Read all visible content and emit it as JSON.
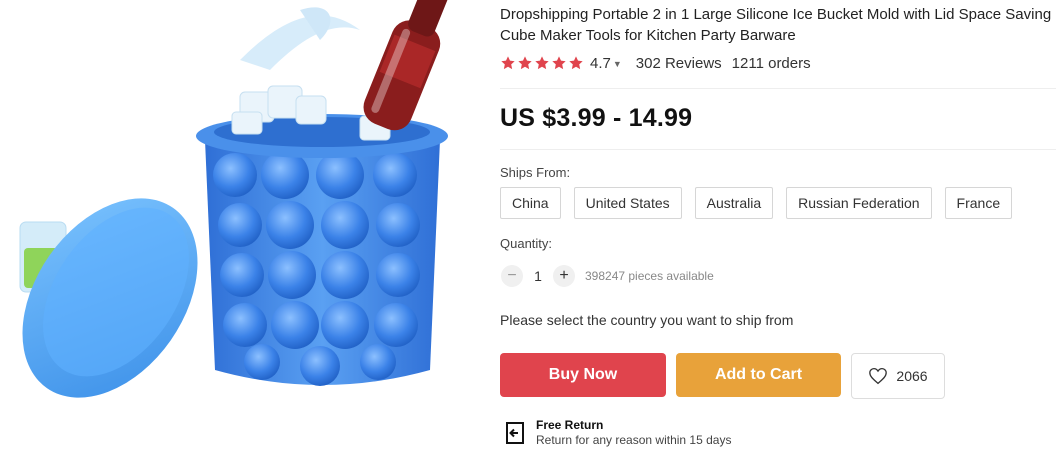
{
  "product": {
    "title": "Dropshipping Portable 2 in 1 Large Silicone Ice Bucket Mold with Lid Space Saving Cube Maker Tools for Kitchen Party Barware",
    "rating": "4.7",
    "rating_stars": 5,
    "reviews": "302 Reviews",
    "orders": "1211 orders",
    "price": "US $3.99 - 14.99"
  },
  "shipping": {
    "label": "Ships From:",
    "options": [
      "China",
      "United States",
      "Australia",
      "Russian Federation",
      "France"
    ],
    "prompt": "Please select the country you want to ship from"
  },
  "quantity": {
    "label": "Quantity:",
    "value": "1",
    "minus": "−",
    "plus": "+",
    "available": "398247 pieces available"
  },
  "actions": {
    "buy_now": "Buy Now",
    "add_to_cart": "Add to Cart",
    "wishlist_count": "2066"
  },
  "return_policy": {
    "title": "Free Return",
    "subtitle": "Return for any reason within 15 days"
  },
  "colors": {
    "star": "#e0444d",
    "buy_now": "#e0444d",
    "add_to_cart": "#e8a23a",
    "ice_bucket": "#4a8fe6"
  }
}
